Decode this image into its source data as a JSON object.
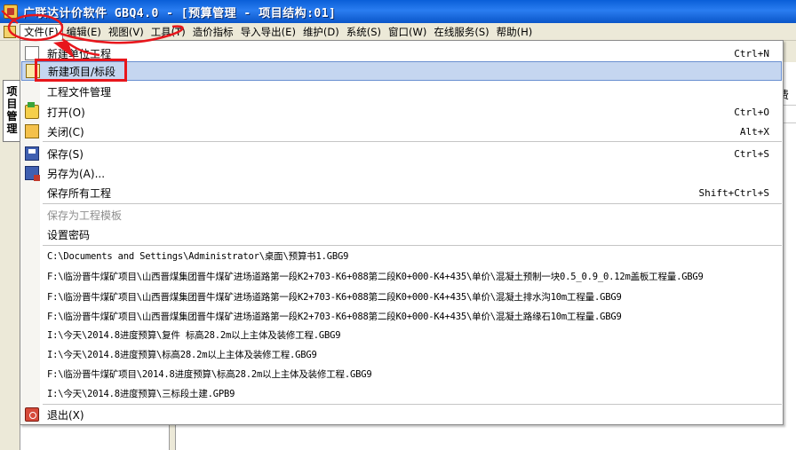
{
  "window": {
    "title": "广联达计价软件 GBQ4.0 - [预算管理 - 项目结构:01]"
  },
  "menubar": {
    "items": [
      {
        "label": "文件(F)",
        "active": true
      },
      {
        "label": "编辑(E)"
      },
      {
        "label": "视图(V)"
      },
      {
        "label": "工具(T)"
      },
      {
        "label": "造价指标"
      },
      {
        "label": "导入导出(E)"
      },
      {
        "label": "维护(D)"
      },
      {
        "label": "系统(S)"
      },
      {
        "label": "窗口(W)"
      },
      {
        "label": "在线服务(S)"
      },
      {
        "label": "帮助(H)"
      }
    ]
  },
  "side_tab": {
    "chars": [
      "项",
      "目",
      "管",
      "理"
    ]
  },
  "background": {
    "right_header": "费"
  },
  "file_menu": {
    "new_project": {
      "label": "新建单位工程",
      "shortcut": "Ctrl+N"
    },
    "new_bid": {
      "label": "新建项目/标段"
    },
    "project_manager": {
      "label": "工程文件管理"
    },
    "open": {
      "label": "打开(O)",
      "shortcut": "Ctrl+O"
    },
    "close": {
      "label": "关闭(C)",
      "shortcut": "Alt+X"
    },
    "save": {
      "label": "保存(S)",
      "shortcut": "Ctrl+S"
    },
    "save_as": {
      "label": "另存为(A)..."
    },
    "save_all": {
      "label": "保存所有工程",
      "shortcut": "Shift+Ctrl+S"
    },
    "save_template": {
      "label": "保存为工程模板"
    },
    "set_password": {
      "label": "设置密码"
    },
    "recent_files": [
      "C:\\Documents and Settings\\Administrator\\桌面\\预算书1.GBG9",
      "F:\\临汾晋牛煤矿项目\\山西晋煤集团晋牛煤矿进场道路第一段K2+703-K6+088第二段K0+000-K4+435\\单价\\混凝土预制一块0.5_0.9_0.12m盖板工程量.GBG9",
      "F:\\临汾晋牛煤矿项目\\山西晋煤集团晋牛煤矿进场道路第一段K2+703-K6+088第二段K0+000-K4+435\\单价\\混凝土排水沟10m工程量.GBG9",
      "F:\\临汾晋牛煤矿项目\\山西晋煤集团晋牛煤矿进场道路第一段K2+703-K6+088第二段K0+000-K4+435\\单价\\混凝土路缘石10m工程量.GBG9",
      "I:\\今天\\2014.8进度预算\\复件 标高28.2m以上主体及装修工程.GBG9",
      "I:\\今天\\2014.8进度预算\\标高28.2m以上主体及装修工程.GBG9",
      "F:\\临汾晋牛煤矿项目\\2014.8进度预算\\标高28.2m以上主体及装修工程.GBG9",
      "I:\\今天\\2014.8进度预算\\三标段土建.GPB9"
    ],
    "exit": {
      "label": "退出(X)"
    }
  },
  "colors": {
    "annotation_red": "#e8161c",
    "highlight": "#c5d6f0",
    "titlebar_blue": "#0a5fd8"
  }
}
